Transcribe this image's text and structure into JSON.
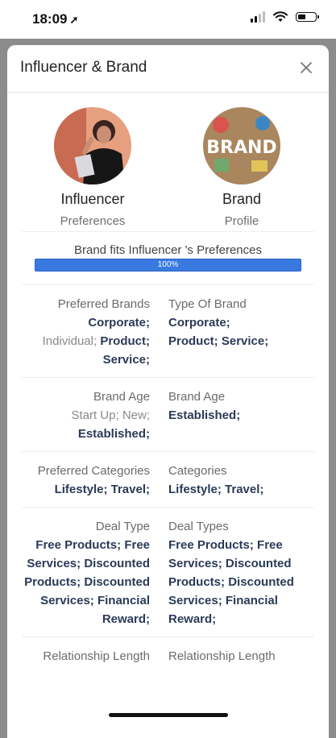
{
  "status_bar": {
    "time": "18:09",
    "location_arrow": "➚",
    "icons": [
      "signal-icon",
      "wifi-icon",
      "battery-icon"
    ]
  },
  "modal": {
    "title": "Influencer & Brand",
    "close_icon": "close-icon"
  },
  "profiles": {
    "left": {
      "label": "Influencer",
      "sub": "Preferences"
    },
    "right": {
      "label": "Brand",
      "sub": "Profile",
      "image_text": "BRAND"
    }
  },
  "fit": {
    "text": "Brand fits Influencer 's Preferences",
    "progress_label": "100%",
    "progress_value": 1.0
  },
  "sections": {
    "brands": {
      "left_label": "Preferred Brands",
      "left_values": [
        "Corporate;",
        "Individual;",
        "Product;",
        "Service;"
      ],
      "right_label": "Type Of Brand",
      "right_values": [
        "Corporate;",
        "Product;",
        "Service;"
      ]
    },
    "age": {
      "left_label": "Brand Age",
      "left_values": [
        "Start Up;",
        "New;",
        "Established;"
      ],
      "right_label": "Brand Age",
      "right_values": [
        "Established;"
      ]
    },
    "categories": {
      "left_label": "Preferred Categories",
      "left_values": [
        "Lifestyle;",
        "Travel;"
      ],
      "right_label": "Categories",
      "right_values": [
        "Lifestyle;",
        "Travel;"
      ]
    },
    "deals": {
      "left_label": "Deal Type",
      "left_values": [
        "Free Products;",
        "Free Services;",
        "Discounted Products;",
        "Discounted Services;",
        "Financial Reward;"
      ],
      "right_label": "Deal Types",
      "right_values": [
        "Free Products;",
        "Free Services;",
        "Discounted Products;",
        "Discounted Services;",
        "Financial Reward;"
      ]
    },
    "relationship": {
      "left_label": "Relationship Length",
      "right_label": "Relationship Length"
    }
  },
  "colors": {
    "accent": "#3a7ae0",
    "value_text": "#2b3a57"
  }
}
